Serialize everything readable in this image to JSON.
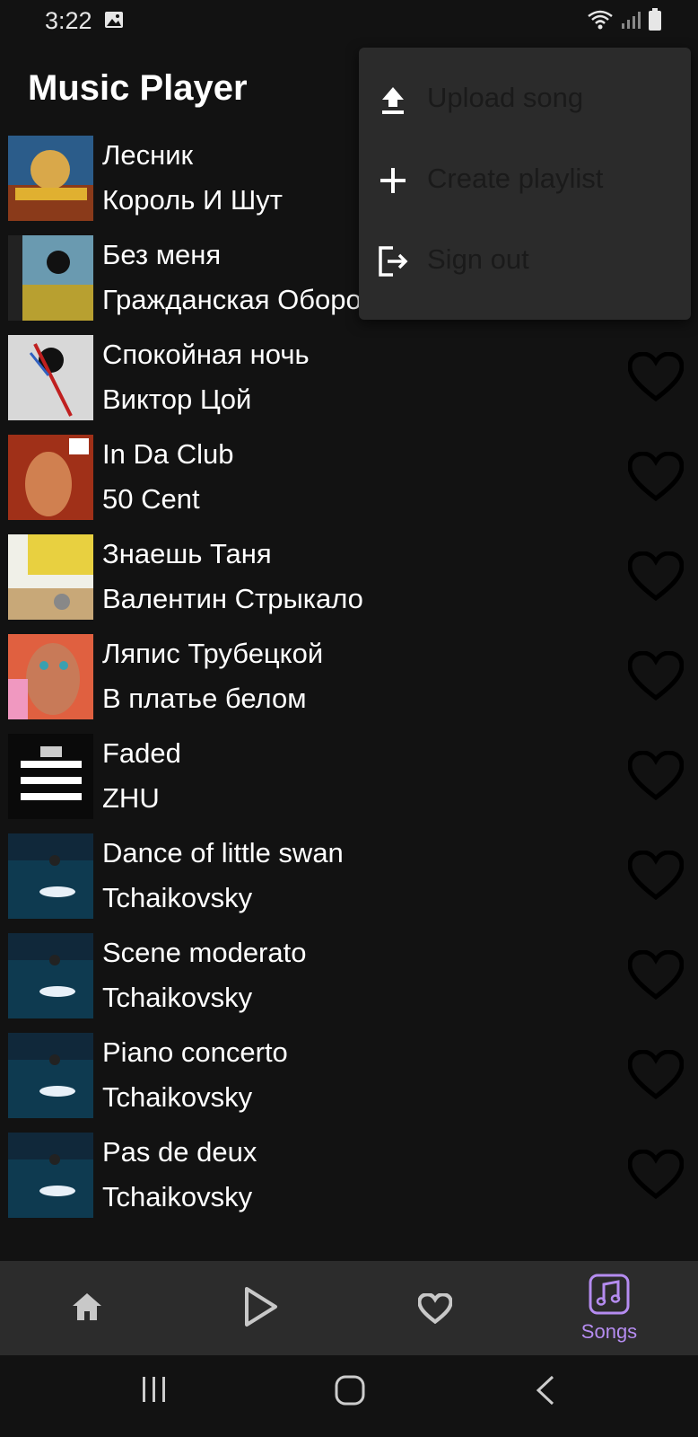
{
  "status": {
    "time": "3:22"
  },
  "app": {
    "title": "Music Player"
  },
  "menu": {
    "items": [
      {
        "label": "Upload song",
        "icon": "upload-icon"
      },
      {
        "label": "Create playlist",
        "icon": "plus-icon"
      },
      {
        "label": "Sign out",
        "icon": "sign-out-icon"
      }
    ]
  },
  "songs": [
    {
      "title": "Лесник",
      "artist": "Король И Шут"
    },
    {
      "title": "Без меня",
      "artist": "Гражданская Оборона"
    },
    {
      "title": "Спокойная ночь",
      "artist": "Виктор Цой"
    },
    {
      "title": "In Da Club",
      "artist": "50 Cent"
    },
    {
      "title": "Знаешь Таня",
      "artist": "Валентин Стрыкало"
    },
    {
      "title": "Ляпис Трубецкой",
      "artist": "В платье белом"
    },
    {
      "title": "Faded",
      "artist": "ZHU"
    },
    {
      "title": "Dance of little swan",
      "artist": "Tchaikovsky"
    },
    {
      "title": "Scene moderato",
      "artist": "Tchaikovsky"
    },
    {
      "title": "Piano concerto",
      "artist": "Tchaikovsky"
    },
    {
      "title": "Pas de deux",
      "artist": "Tchaikovsky"
    }
  ],
  "bottom_nav": {
    "items": [
      {
        "icon": "home-icon",
        "label": ""
      },
      {
        "icon": "play-icon",
        "label": ""
      },
      {
        "icon": "heart-icon",
        "label": ""
      },
      {
        "icon": "music-note-icon",
        "label": "Songs"
      }
    ],
    "active_color": "#b58cf0"
  },
  "colors": {
    "background": "#121212",
    "menu_bg": "#2b2b2b",
    "nav_bg": "#2c2c2c",
    "accent": "#b58cf0"
  }
}
